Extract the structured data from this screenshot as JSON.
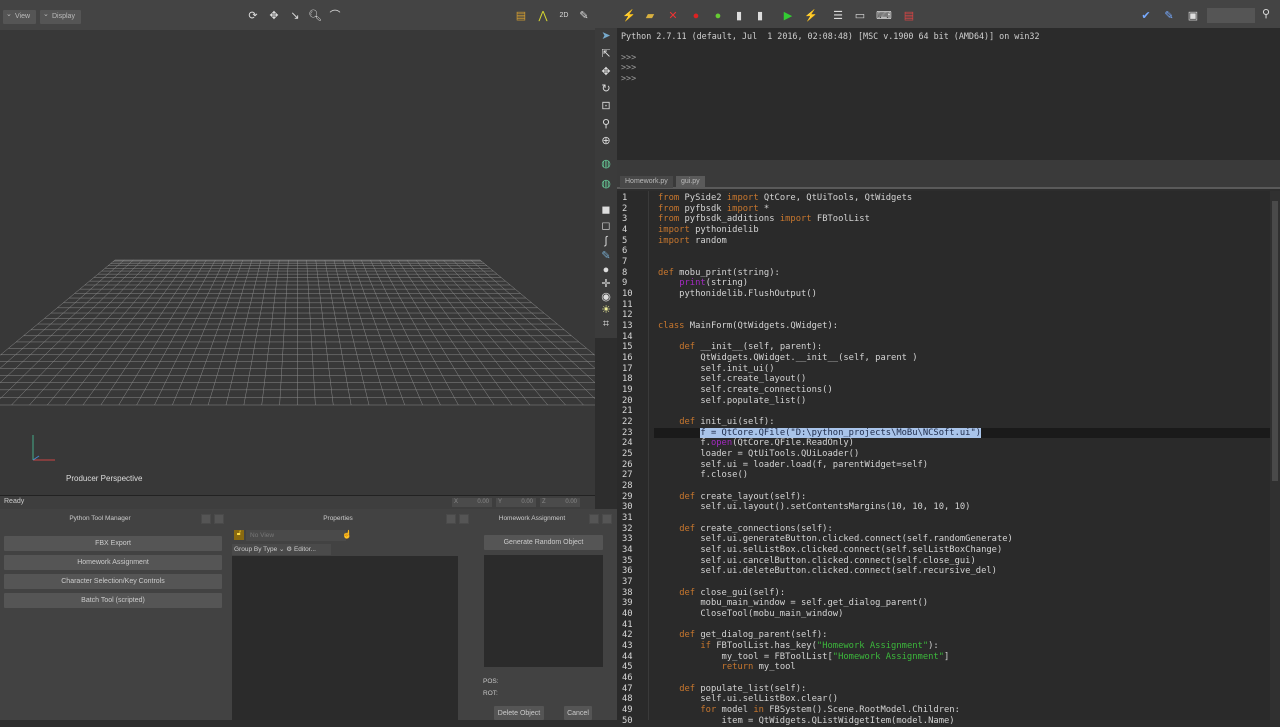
{
  "viewer": {
    "title": "Viewer",
    "view_label": "View",
    "display_label": "Display",
    "camera_label": "Producer Perspective",
    "axis_y": "y",
    "axis_x": "x"
  },
  "status": {
    "text": "Ready",
    "x_label": "X",
    "x_value": "0.00",
    "y_label": "Y",
    "y_value": "0.00",
    "z_label": "Z",
    "z_value": "0.00"
  },
  "python_editor": {
    "title": "Python Editor",
    "console": {
      "banner": "Python 2.7.11 (default, Jul  1 2016, 02:08:48) [MSC v.1900 64 bit (AMD64)] on win32",
      "prompts": [
        ">>>",
        ">>>",
        ">>>"
      ]
    },
    "tabs": [
      {
        "label": "Homework.py"
      },
      {
        "label": "gui.py"
      }
    ],
    "active_tab": "gui.py",
    "current_line": 23,
    "code": [
      [
        [
          "k",
          "from"
        ],
        [
          "t",
          " PySide2 "
        ],
        [
          "k",
          "import"
        ],
        [
          "t",
          " QtCore, QtUiTools, QtWidgets"
        ]
      ],
      [
        [
          "k",
          "from"
        ],
        [
          "t",
          " pyfbsdk "
        ],
        [
          "k",
          "import"
        ],
        [
          "t",
          " *"
        ]
      ],
      [
        [
          "k",
          "from"
        ],
        [
          "t",
          " pyfbsdk_additions "
        ],
        [
          "k",
          "import"
        ],
        [
          "t",
          " FBToolList"
        ]
      ],
      [
        [
          "k",
          "import"
        ],
        [
          "t",
          " pythonidelib"
        ]
      ],
      [
        [
          "k",
          "import"
        ],
        [
          "t",
          " random"
        ]
      ],
      [],
      [],
      [
        [
          "k",
          "def"
        ],
        [
          "t",
          " mobu_print(string):"
        ]
      ],
      [
        [
          "t",
          "    "
        ],
        [
          "p",
          "print"
        ],
        [
          "t",
          "(string)"
        ]
      ],
      [
        [
          "t",
          "    pythonidelib.FlushOutput()"
        ]
      ],
      [],
      [],
      [
        [
          "k",
          "class"
        ],
        [
          "t",
          " MainForm(QtWidgets.QWidget):"
        ]
      ],
      [],
      [
        [
          "t",
          "    "
        ],
        [
          "k",
          "def"
        ],
        [
          "t",
          " __init__(self, parent):"
        ]
      ],
      [
        [
          "t",
          "        QtWidgets.QWidget.__init__(self, parent )"
        ]
      ],
      [
        [
          "t",
          "        self.init_ui()"
        ]
      ],
      [
        [
          "t",
          "        self.create_layout()"
        ]
      ],
      [
        [
          "t",
          "        self.create_connections()"
        ]
      ],
      [
        [
          "t",
          "        self.populate_list()"
        ]
      ],
      [],
      [
        [
          "t",
          "    "
        ],
        [
          "k",
          "def"
        ],
        [
          "t",
          " init_ui(self):"
        ]
      ],
      [
        [
          "t",
          "        "
        ],
        [
          "sel",
          "f = QtCore.QFile(\"D:\\python_projects\\MoBu\\NCSoft.ui\")"
        ]
      ],
      [
        [
          "t",
          "        f."
        ],
        [
          "p",
          "open"
        ],
        [
          "t",
          "(QtCore.QFile.ReadOnly)"
        ]
      ],
      [
        [
          "t",
          "        loader = QtUiTools.QUiLoader()"
        ]
      ],
      [
        [
          "t",
          "        self.ui = loader.load(f, parentWidget=self)"
        ]
      ],
      [
        [
          "t",
          "        f.close()"
        ]
      ],
      [],
      [
        [
          "t",
          "    "
        ],
        [
          "k",
          "def"
        ],
        [
          "t",
          " create_layout(self):"
        ]
      ],
      [
        [
          "t",
          "        self.ui.layout().setContentsMargins(10, 10, 10, 10)"
        ]
      ],
      [],
      [
        [
          "t",
          "    "
        ],
        [
          "k",
          "def"
        ],
        [
          "t",
          " create_connections(self):"
        ]
      ],
      [
        [
          "t",
          "        self.ui.generateButton.clicked.connect(self.randomGenerate)"
        ]
      ],
      [
        [
          "t",
          "        self.ui.selListBox.clicked.connect(self.selListBoxChange)"
        ]
      ],
      [
        [
          "t",
          "        self.ui.cancelButton.clicked.connect(self.close_gui)"
        ]
      ],
      [
        [
          "t",
          "        self.ui.deleteButton.clicked.connect(self.recursive_del)"
        ]
      ],
      [],
      [
        [
          "t",
          "    "
        ],
        [
          "k",
          "def"
        ],
        [
          "t",
          " close_gui(self):"
        ]
      ],
      [
        [
          "t",
          "        mobu_main_window = self.get_dialog_parent()"
        ]
      ],
      [
        [
          "t",
          "        CloseTool(mobu_main_window)"
        ]
      ],
      [],
      [
        [
          "t",
          "    "
        ],
        [
          "k",
          "def"
        ],
        [
          "t",
          " get_dialog_parent(self):"
        ]
      ],
      [
        [
          "t",
          "        "
        ],
        [
          "k",
          "if"
        ],
        [
          "t",
          " FBToolList.has_key("
        ],
        [
          "s",
          "\"Homework Assignment\""
        ],
        [
          "t",
          "):"
        ]
      ],
      [
        [
          "t",
          "            my_tool = FBToolList["
        ],
        [
          "s",
          "\"Homework Assignment\""
        ],
        [
          "t",
          "]"
        ]
      ],
      [
        [
          "t",
          "            "
        ],
        [
          "k",
          "return"
        ],
        [
          "t",
          " my_tool"
        ]
      ],
      [],
      [
        [
          "t",
          "    "
        ],
        [
          "k",
          "def"
        ],
        [
          "t",
          " populate_list(self):"
        ]
      ],
      [
        [
          "t",
          "        self.ui.selListBox.clear()"
        ]
      ],
      [
        [
          "t",
          "        "
        ],
        [
          "k",
          "for"
        ],
        [
          "t",
          " model "
        ],
        [
          "k",
          "in"
        ],
        [
          "t",
          " FBSystem().Scene.RootModel.Children:"
        ]
      ],
      [
        [
          "t",
          "            item = QtWidgets.QListWidgetItem(model.Name)"
        ]
      ]
    ]
  },
  "tool_manager": {
    "title": "Python Tool Manager",
    "tools": [
      {
        "label": "FBX Export"
      },
      {
        "label": "Homework Assignment"
      },
      {
        "label": "Character Selection/Key Controls"
      },
      {
        "label": "Batch Tool (scripted)"
      }
    ]
  },
  "properties": {
    "title": "Properties",
    "view_select": "No View",
    "group_by": "Group By Type",
    "editor_label": "Editor..."
  },
  "homework": {
    "title": "Homework Assignment",
    "generate_label": "Generate Random Object",
    "pos_label": "POS:",
    "rot_label": "ROT:",
    "delete_label": "Delete Object",
    "cancel_label": "Cancel"
  },
  "colors": {
    "keyword": "#c8772e",
    "builtin": "#a22ac0",
    "string": "#3cb83c",
    "selection": "#a9c4ea"
  }
}
